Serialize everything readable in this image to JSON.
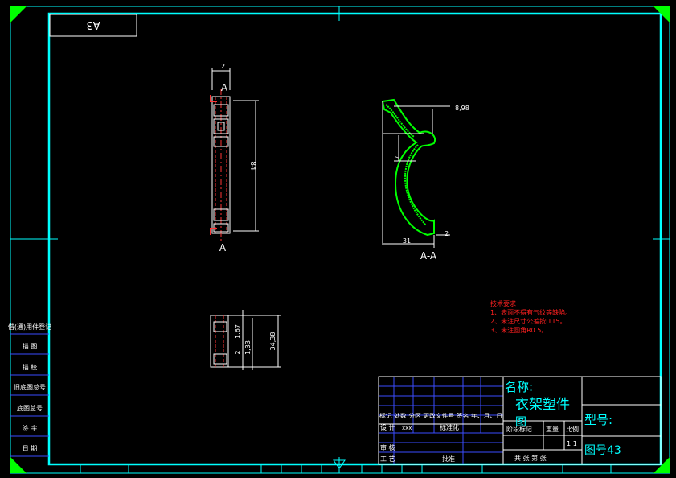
{
  "sheet": {
    "code_box": "A3",
    "colors": {
      "frame": "#00ffff",
      "corner": "#00ff00",
      "part": "#ff3333",
      "hatch": "#00ff00",
      "dim": "#ffffff",
      "notes": "#ff2020",
      "grid": "#3a4dff",
      "title": "#00ffff"
    }
  },
  "views": {
    "front": {
      "top_label": "A",
      "bottom_label": "A",
      "dim_width": "12",
      "dim_height": "84"
    },
    "section": {
      "label": "A-A",
      "dim_top": "8,98",
      "dim_mid": "7",
      "dim_bottom_right": "2",
      "dim_base": "31"
    },
    "bottom": {
      "dim_a": "1,67",
      "dim_b": "2",
      "dim_c": "1,33",
      "dim_d": "34,38"
    }
  },
  "notes": {
    "heading": "技术要求",
    "items": [
      "1、表面不得有气纹等缺陷。",
      "2、未注尺寸公差按IT15。",
      "3、未注圆角R0.5。"
    ]
  },
  "left_column": [
    "借(通)用件登记",
    "描 图",
    "描 校",
    "旧底图总号",
    "底图总号",
    "签 字",
    "日 期"
  ],
  "title_block": {
    "name_label": "名称:",
    "part_name": "衣架塑件",
    "part_name_tail": "图",
    "model_label": "型号:",
    "drawing_no": "图号43",
    "rev_header": "标记 处数  分区  更改文件号  签名  年、月、日",
    "design_label": "设 计",
    "design_value": "xxx",
    "std_label": "标准化",
    "review_label": "审 核",
    "process_label": "工 艺",
    "approve_label": "批准",
    "stage_label": "阶段标记",
    "weight_label": "重量",
    "scale_label": "比例",
    "scale_value": "1:1",
    "sheets_label": "共   张   第   张"
  }
}
